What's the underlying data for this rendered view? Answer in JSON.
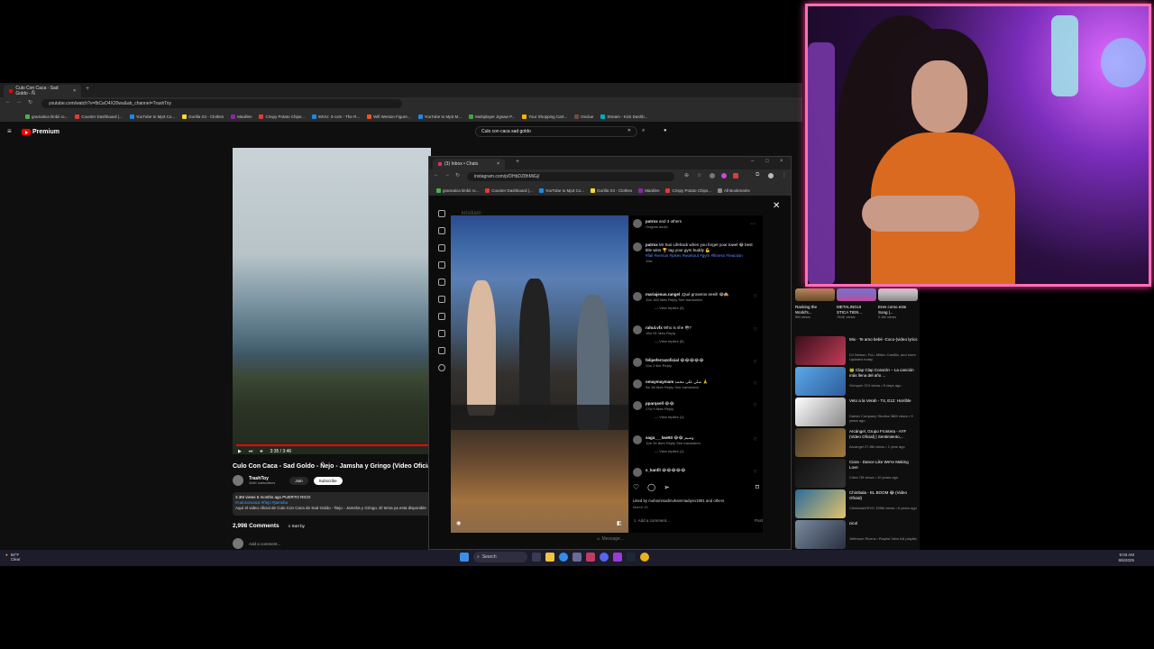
{
  "youtube": {
    "tab_title": "Culo Con Caca - Sad Goldo - Ñ",
    "url": "youtube.com/watch?v=fbCaO4X20ws&ab_channel=TrashToy",
    "bookmarks": [
      "gramatica limbii ro...",
      "Counter Dashboard |...",
      "YouTube to Mp3 Co...",
      "Gorilla X3 - Clothes",
      "Mardlen",
      "Crispy Potato Chips...",
      "IMVU: 3-com - The R...",
      "Will Weston Figure...",
      "YouTube to Mp3 M...",
      "Multiplayer Jigsaw P...",
      "Your Shopping Cart...",
      "Onclue",
      "Stream - Kick Dashb..."
    ],
    "logo": "Premium",
    "search_value": "Culo con caca sad goldo",
    "time": "3:35 / 3:46",
    "video_title": "Culo Con Caca - Sad Goldo - Ñejo - Jamsha y Gringo (Video Oficial)",
    "channel_name": "TrashToy",
    "subscribers": "344K subscribers",
    "join_label": "Join",
    "subscribe_label": "Subscribe",
    "desc_stats": "3.3M views  5 months ago  PUERTO RICO",
    "desc_tags": "#culoconcaca #ñejo #jamsha",
    "desc_text": "Aquí el video oficial de Culo Con Caca de Sad Goldo - Ñejo - Jamsha y Gringo. El tema ya esta disponible",
    "comments_count": "2,998 Comments",
    "sort_label": "Sort by",
    "add_comment": "Add a comment..."
  },
  "instagram": {
    "tab_title": "(3) Inbox • Chats",
    "url": "instagram.com/p/DHbDZ8hMiGj/",
    "bookmarks": [
      "gramatica limbii ro...",
      "Counter Dashboard |...",
      "YouTube to Mp3 Co...",
      "Gorilla X3 - Clothes",
      "Mardlen",
      "Crispy Potato Chips...",
      "All Bookmarks"
    ],
    "header_user": "patrox",
    "header_others": "and 3 others",
    "header_sub": "Original audio",
    "comments": [
      {
        "user": "patrox",
        "text": "Mr Sus Lifehack when you forget your towel 😂 best title wins 🏆 tag your gym buddy 💪",
        "tags": "#fail #versus #jokes #workout #gym #fitness #reaction",
        "meta": "19w"
      },
      {
        "user": "mariajesus.rangel",
        "text": "¡Qué groseros eeeil! 😂🙈",
        "meta": "11w  183 likes  Reply  See translation",
        "replies": "View replies (3)"
      },
      {
        "user": "rahul.vfx",
        "text": "Who is she 😳?",
        "meta": "16w  51 likes  Reply",
        "replies": "View replies (5)"
      },
      {
        "user": "felipeferrazoficial",
        "text": "😂😂😂😂😂",
        "meta": "11w  1 like  Reply"
      },
      {
        "user": "omaymaymam",
        "text": "صلي على محمد 🙏",
        "meta": "9w  38 likes  Reply  See translation"
      },
      {
        "user": "pparqsell",
        "text": "😂😂",
        "meta": "17w  9 likes  Reply",
        "replies": "View replies (1)"
      },
      {
        "user": "saga___law93",
        "text": "😂😂 وسيم",
        "meta": "11w  34 likes  Reply  See translation",
        "replies": "View replies (1)"
      },
      {
        "user": "s_kanfil",
        "text": "😂😂😂😂😂",
        "meta": ""
      }
    ],
    "liked_by": "Liked by muhammadmuhammadiyev1991 and others",
    "date": "March 20",
    "add_comment": "Add a comment...",
    "post_label": "Post",
    "message_placeholder": "Message...",
    "dim_user": "krisiliam_"
  },
  "recs": {
    "shorts": [
      {
        "title": "Ranking the World's...",
        "views": "9M views"
      },
      {
        "title": "METALINGUI STICA TIEN...",
        "views": "764K views"
      },
      {
        "title": "Eres como este Song |...",
        "views": "2.4M views"
      }
    ],
    "videos": [
      {
        "title": "Mix - Te amo bebé -Coco-(video lyrics",
        "meta": "DJ Nelson, Fuu, Milton Castillo, and more Updated today"
      },
      {
        "title": "🐸 Clap Clap Corazón – La canción más llena del año ...",
        "meta": "Grinquín  374 views • 5 days ago"
      },
      {
        "title": "Veto a la Verah - T4, E12: Horrible",
        "meta": "Darker Company Studios  38M views • 9 years ago"
      },
      {
        "title": "Arcángel, Grupo Frontera - AYF (Video Oficial) | Sentimiento,...",
        "meta": "Arcangel  27.8M views • 1 year ago"
      },
      {
        "title": "Ciara - Dance Like We're Making Love",
        "meta": "Ciara  7M views • 10 years ago"
      },
      {
        "title": "Chimbala - EL BOOM 😂 (Video Oficial)",
        "meta": "ChimbalaVEVO  155M views • 6 years ago"
      },
      {
        "title": "nicol",
        "meta": "Jefferson Rivera • Playlist  View full playlist"
      }
    ]
  },
  "taskbar": {
    "temp": "58°F",
    "weather": "Clear",
    "search": "Search",
    "time": "9:03 AM",
    "date": "8/6/2025"
  }
}
